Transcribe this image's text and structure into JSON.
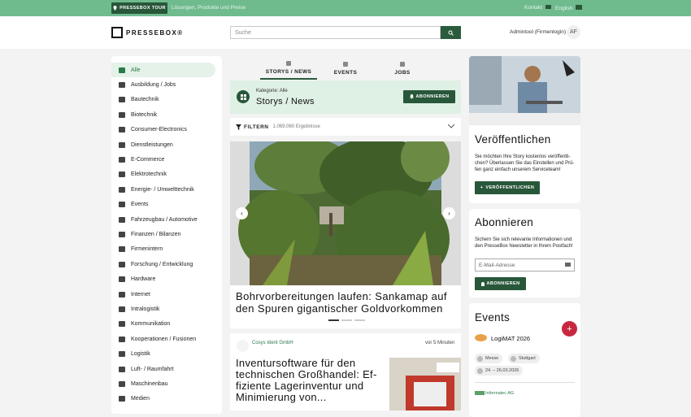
{
  "topbar": {
    "tour_label": "PRESSEBOX TOUR",
    "tagline": "Lösungen, Produkte und Preise",
    "contact_label": "Kontakt",
    "language_label": "English"
  },
  "header": {
    "logo_text": "PRESSEBOX®",
    "search_placeholder": "Suche",
    "user_name": "Admintool (Firmenlogin)",
    "avatar_initials": "AF"
  },
  "sidebar": {
    "items": [
      {
        "label": "Alle",
        "icon": "grid-icon"
      },
      {
        "label": "Ausbildung / Jobs",
        "icon": "briefcase-icon"
      },
      {
        "label": "Bautechnik",
        "icon": "excavator-icon"
      },
      {
        "label": "Biotechnik",
        "icon": "leaf-icon"
      },
      {
        "label": "Consumer-Electronics",
        "icon": "devices-icon"
      },
      {
        "label": "Dienstleistungen",
        "icon": "service-icon"
      },
      {
        "label": "E-Commerce",
        "icon": "cart-icon"
      },
      {
        "label": "Elektrotechnik",
        "icon": "bolt-icon"
      },
      {
        "label": "Energie- / Umwelttechnik",
        "icon": "battery-icon"
      },
      {
        "label": "Events",
        "icon": "calendar-icon"
      },
      {
        "label": "Fahrzeugbau / Automotive",
        "icon": "car-icon"
      },
      {
        "label": "Finanzen / Bilanzen",
        "icon": "piggybank-icon"
      },
      {
        "label": "Firmenintern",
        "icon": "building-icon"
      },
      {
        "label": "Forschung / Entwicklung",
        "icon": "flask-icon"
      },
      {
        "label": "Hardware",
        "icon": "chip-icon"
      },
      {
        "label": "Internet",
        "icon": "laptop-icon"
      },
      {
        "label": "Intralogistik",
        "icon": "warehouse-icon"
      },
      {
        "label": "Kommunikation",
        "icon": "phone-icon"
      },
      {
        "label": "Kooperationen / Fusionen",
        "icon": "merge-icon"
      },
      {
        "label": "Logistik",
        "icon": "truck-icon"
      },
      {
        "label": "Luft- / Raumfahrt",
        "icon": "plane-icon"
      },
      {
        "label": "Maschinenbau",
        "icon": "gears-icon"
      },
      {
        "label": "Medien",
        "icon": "media-icon"
      }
    ]
  },
  "tabs": [
    {
      "label": "STORYS / NEWS",
      "active": true
    },
    {
      "label": "EVENTS",
      "active": false
    },
    {
      "label": "JOBS",
      "active": false
    }
  ],
  "category": {
    "small": "Kategorie: Alle",
    "big": "Storys / News",
    "subscribe_label": "ABONNIEREN"
  },
  "filter": {
    "label": "FILTERN",
    "count": "1.069.060 Ergebnisse"
  },
  "featured": {
    "title": "Bohrvorbereitungen laufen: Sankamap auf den Spuren gigantischer Goldvorkommen"
  },
  "story": {
    "company": "Cosys Ident GmbH",
    "time": "vor 5 Minuten",
    "headline": "Inventursoftware für den technischen Großhandel: Ef-fiziente Lagerinventur und Minimierung von..."
  },
  "publish": {
    "title": "Veröffentlichen",
    "text": "Sie möchten Ihre Story kostenlos veröffentli-chen? Überlassen Sie das Einstellen und Prü-fen ganz einfach unserem Serviceteam!",
    "button": "VERÖFFENTLICHEN"
  },
  "newsletter": {
    "title": "Abonnieren",
    "text": "Sichern Sie sich relevante Informationen und den PresseBox Newsletter in Ihrem Postfach!",
    "email_placeholder": "E-Mail-Adresse",
    "button": "ABONNIEREN"
  },
  "events": {
    "title": "Events",
    "event_name": "LogiMAT 2026",
    "type": "Messe",
    "city": "Stuttgart",
    "dates": "24. – 26.03.2026",
    "next_company": "Informatec AG"
  },
  "colors": {
    "accent": "#28573a",
    "topbar": "#6fbb8e",
    "add": "#c8283f"
  }
}
